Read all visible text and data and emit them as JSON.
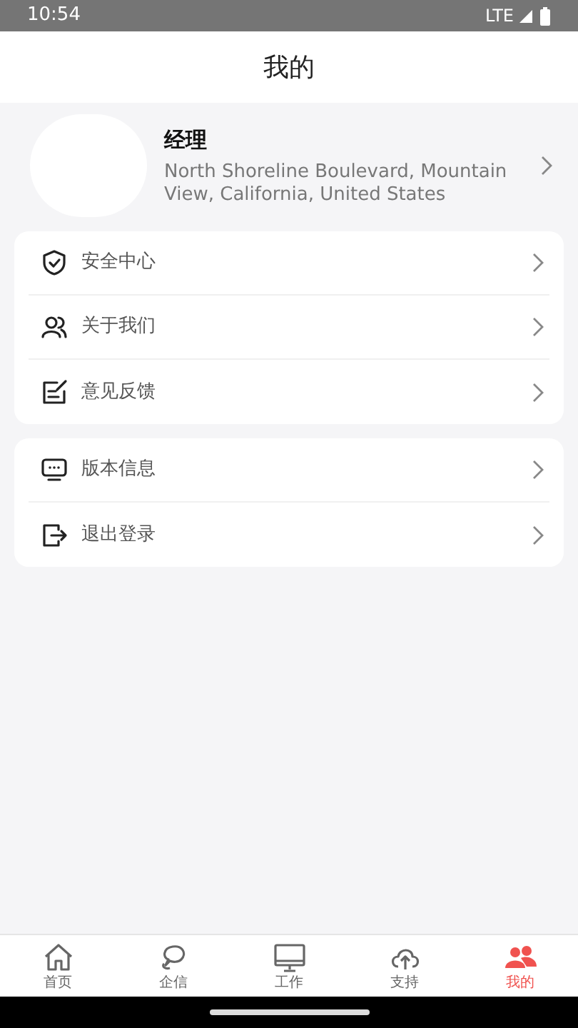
{
  "status_bar": {
    "time": "10:54",
    "network": "LTE"
  },
  "header": {
    "title": "我的"
  },
  "profile": {
    "name": "经理",
    "address": "North Shoreline Boulevard, Mountain View, California, United States"
  },
  "menu_groups": [
    {
      "items": [
        {
          "kind": "shield",
          "label": "安全中心"
        },
        {
          "kind": "people",
          "label": "关于我们"
        },
        {
          "kind": "edit",
          "label": "意见反馈"
        }
      ]
    },
    {
      "items": [
        {
          "kind": "monitor",
          "label": "版本信息"
        },
        {
          "kind": "logout",
          "label": "退出登录"
        }
      ]
    }
  ],
  "tab_bar": [
    {
      "kind": "home",
      "label": "首页",
      "selected": false
    },
    {
      "kind": "chat",
      "label": "企信",
      "selected": false
    },
    {
      "kind": "desktop",
      "label": "工作",
      "selected": false
    },
    {
      "kind": "cloud",
      "label": "支持",
      "selected": false
    },
    {
      "kind": "users",
      "label": "我的",
      "selected": true
    }
  ]
}
